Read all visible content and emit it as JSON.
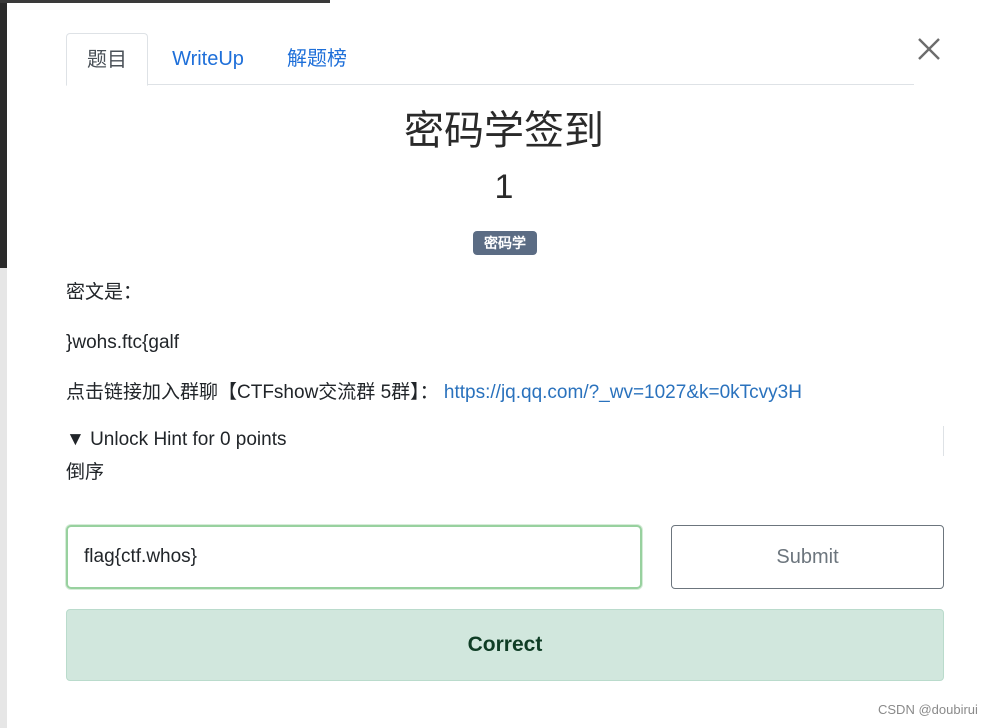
{
  "tabs": [
    {
      "label": "题目",
      "active": true
    },
    {
      "label": "WriteUp",
      "active": false
    },
    {
      "label": "解题榜",
      "active": false
    }
  ],
  "close": {
    "icon": "close-icon"
  },
  "challenge": {
    "title": "密码学签到",
    "points": "1",
    "category": "密码学",
    "description_label": "密文是：",
    "ciphertext": "}wohs.ftc{galf",
    "group_text": "点击链接加入群聊【CTFshow交流群 5群】：",
    "group_link": "https://jq.qq.com/?_wv=1027&k=0kTcvy3H"
  },
  "hint": {
    "summary": "▼ Unlock Hint for 0 points",
    "content": "倒序"
  },
  "submission": {
    "value": "flag{ctf.whos}",
    "button_label": "Submit",
    "result": "Correct"
  },
  "watermark": "CSDN @doubirui",
  "colors": {
    "link": "#2a72bd",
    "badge": "#5b6c84",
    "success_bg": "#d1e7dd",
    "input_focus": "#98d19f"
  }
}
